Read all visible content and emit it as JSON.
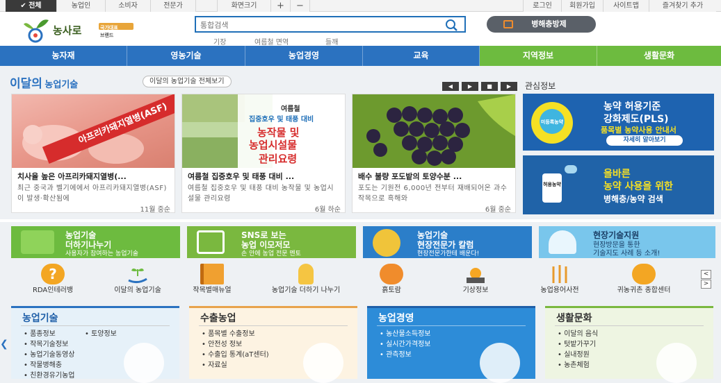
{
  "top_tabs": [
    {
      "label": "✔ 전체",
      "active": true
    },
    {
      "label": "농업인",
      "active": false
    },
    {
      "label": "소비자",
      "active": false
    },
    {
      "label": "전문가",
      "active": false
    }
  ],
  "font_size": {
    "label": "화면크기",
    "plus": "+",
    "minus": "−"
  },
  "util_links": [
    "로그인",
    "회원가입",
    "사이트맵",
    "즐겨찾기 추가"
  ],
  "logo": {
    "name": "농사로",
    "sub1": "국가대표",
    "sub2": "브랜드"
  },
  "search": {
    "placeholder": "통합검색",
    "keywords": [
      "기장",
      "여름철 면역",
      "들깨"
    ]
  },
  "pest_button": "병해충방제",
  "nav": [
    "농자재",
    "영농기술",
    "농업경영",
    "교육",
    "지역정보",
    "생활문화"
  ],
  "month": {
    "title_a": "이달의",
    "title_b": "농업기술",
    "all_link": "이달의 농업기술 전체보기",
    "controls": [
      "◀",
      "▶",
      "■",
      "▶"
    ],
    "cards": [
      {
        "img_text": "아프리카돼지열병(ASF)",
        "title": "치사율 높은 아프리카돼지열병(...",
        "desc": "최근 중국과 벨기에에서 아프리카돼지열병(ASF)이 발생·확산됨에",
        "month": "11월 중순"
      },
      {
        "img_top": "여름철",
        "img_sub": "집중호우 및 태풍 대비",
        "img_main1": "농작물 및",
        "img_main2": "농업시설물",
        "img_main3": "관리요령",
        "title": "여름철 집중호우 및 태풍 대비 ...",
        "desc": "여름철 집중호우 및 태풍 대비 농작물 및 농업시설물 관리요령",
        "month": "6월 하순"
      },
      {
        "title": "배수 불량 포도밭의 토양수분 ...",
        "desc": "포도는 기원전 6,000년 전부터 재배되어온 과수 작목으로 흑해와",
        "month": "6월 중순"
      }
    ]
  },
  "interest": {
    "title": "관심정보",
    "banners": [
      {
        "line1": "농약 허용기준",
        "line2": "강화제도(PLS)",
        "line3": "품목별 농약사용 안내서",
        "button": "자세히 알아보기",
        "badge": "미등록농약"
      },
      {
        "line1": "올바른",
        "line2": "농약 사용을 위한",
        "line3": "병해충/농약 검색",
        "badge": "허용농약"
      }
    ]
  },
  "features": [
    {
      "t1": "농업기술",
      "t2": "더하기나누기",
      "t3": "사용자가 참여하는 농업기술",
      "color": "#6dbb3f"
    },
    {
      "t1": "SNS로 보는",
      "t2": "농업 이모저모",
      "t3": "손 안에 농업 전문 멘토",
      "color": "#7ab83f"
    },
    {
      "t1": "농업기술",
      "t2": "현장전문가 칼럼",
      "t3": "현장전문가한테 배운다!",
      "color": "#2b7ec9"
    },
    {
      "t1": "현장기술지원",
      "t2": "현장방문을 통한",
      "t3": "기술지도 사례 등 소개!",
      "color": "#79c6ec"
    }
  ],
  "quick_icons": [
    {
      "label": "RDA인테러뱅",
      "icon": "question-icon"
    },
    {
      "label": "이달의 농업기술",
      "icon": "sprout-hand-icon"
    },
    {
      "label": "작목별매뉴얼",
      "icon": "book-icon"
    },
    {
      "label": "농업기술 더하기 나누기",
      "icon": "bulb-icon"
    },
    {
      "label": "흙토람",
      "icon": "soil-icon"
    },
    {
      "label": "기상정보",
      "icon": "sun-cloud-icon"
    },
    {
      "label": "농업용어사전",
      "icon": "wheat-icon"
    },
    {
      "label": "귀농귀촌 종합센터",
      "icon": "leaf-icon"
    }
  ],
  "boxes": [
    {
      "title": "농업기술",
      "items": [
        "품종정보",
        "토양정보",
        "작목기술정보",
        "농업기술동영상",
        "작물병해충",
        "친환경유기농업"
      ],
      "color": "#2b72c0",
      "bg": "#e6f1f9"
    },
    {
      "title": "수출농업",
      "items": [
        "품목별 수출정보",
        "안전성 정보",
        "수출입 통계(aT센터)",
        "자료실"
      ],
      "color": "#e8a34c",
      "bg": "#fdf3e2"
    },
    {
      "title": "농업경영",
      "items": [
        "농산물소득정보",
        "실시간가격정보",
        "관측정보"
      ],
      "color": "#2b72c0",
      "bg": "#2d8cd8"
    },
    {
      "title": "생활문화",
      "items": [
        "이달의 음식",
        "텃밭가꾸기",
        "실내정원",
        "농촌체험"
      ],
      "color": "#7ab83f",
      "bg": "#eef5e2"
    }
  ]
}
